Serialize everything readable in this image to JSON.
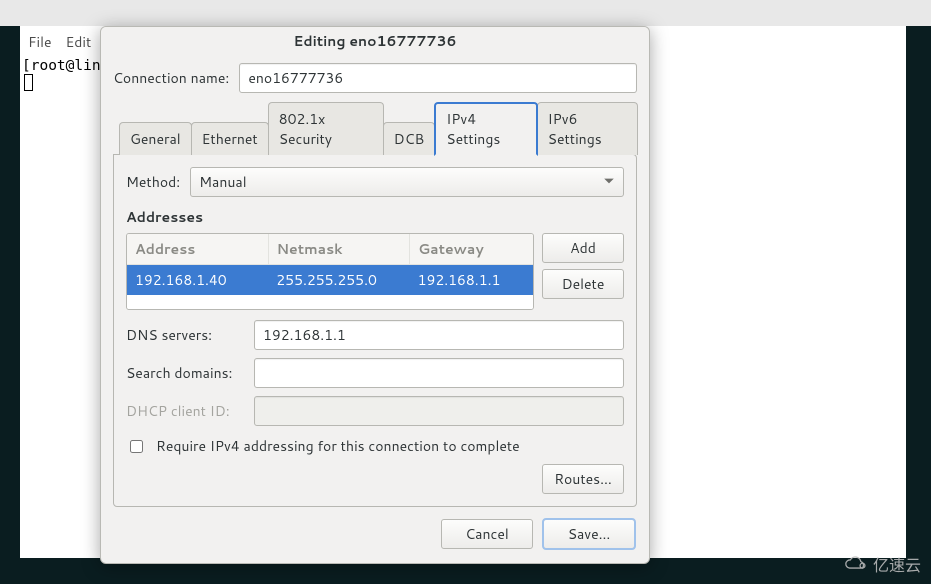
{
  "terminal": {
    "menu": {
      "file": "File",
      "edit": "Edit"
    },
    "prompt": "[root@lin"
  },
  "dialog": {
    "title": "Editing eno16777736",
    "connection_label": "Connection name:",
    "connection_value": "eno16777736",
    "tabs": {
      "general": "General",
      "ethernet": "Ethernet",
      "security": "802.1x Security",
      "dcb": "DCB",
      "ipv4": "IPv4 Settings",
      "ipv6": "IPv6 Settings"
    },
    "method_label": "Method:",
    "method_value": "Manual",
    "addresses_label": "Addresses",
    "addr_head": {
      "address": "Address",
      "netmask": "Netmask",
      "gateway": "Gateway"
    },
    "addr_rows": [
      {
        "address": "192.168.1.40",
        "netmask": "255.255.255.0",
        "gateway": "192.168.1.1"
      }
    ],
    "btn_add": "Add",
    "btn_delete": "Delete",
    "dns_label": "DNS servers:",
    "dns_value": "192.168.1.1",
    "search_label": "Search domains:",
    "search_value": "",
    "dhcp_label": "DHCP client ID:",
    "dhcp_value": "",
    "require_label": "Require IPv4 addressing for this connection to complete",
    "require_checked": false,
    "routes_btn": "Routes...",
    "cancel_btn": "Cancel",
    "save_btn": "Save..."
  },
  "watermark": "亿速云"
}
